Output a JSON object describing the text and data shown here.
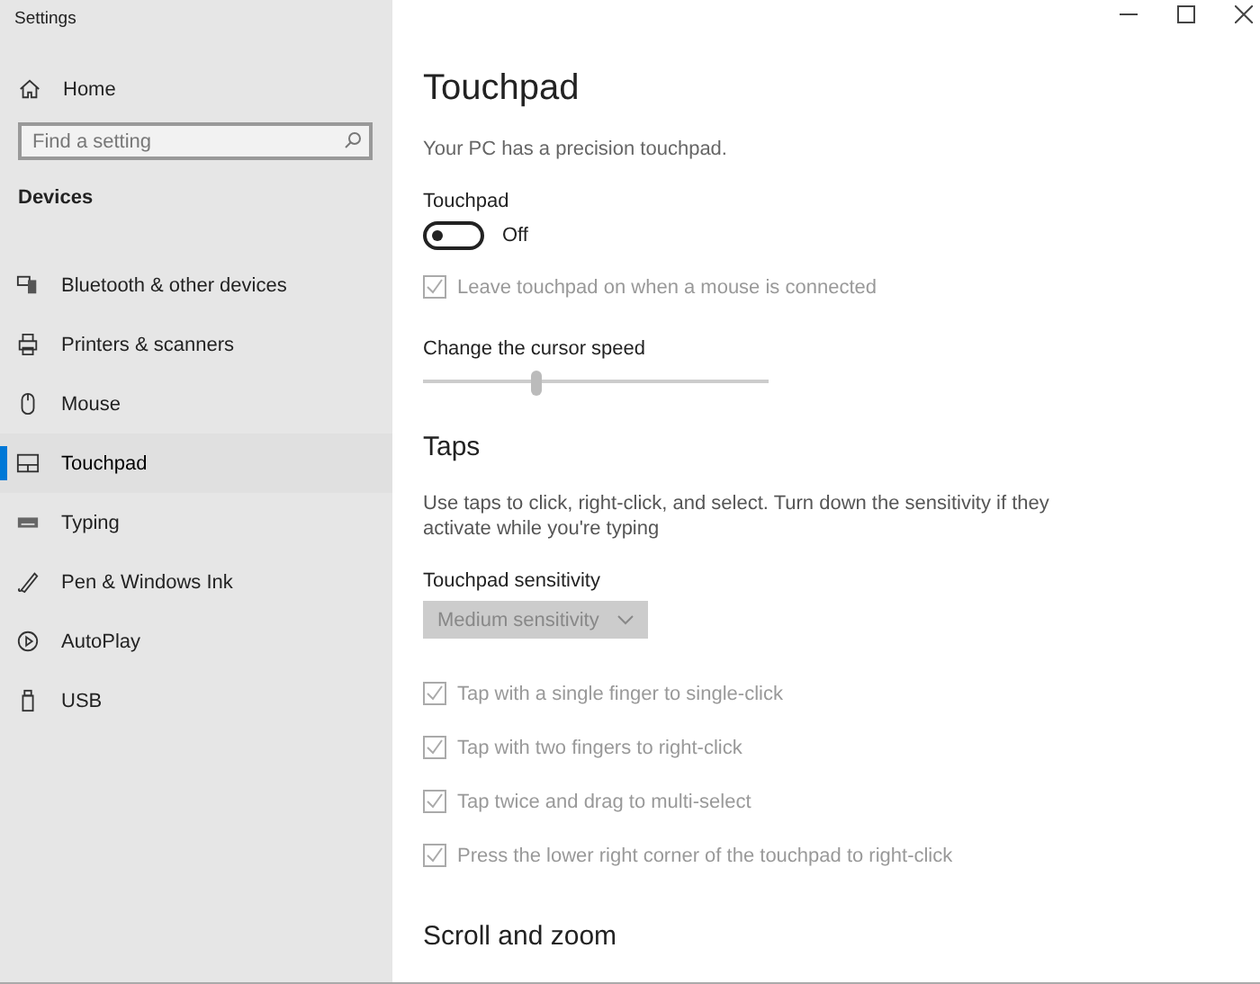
{
  "window": {
    "title": "Settings"
  },
  "sidebar": {
    "home": "Home",
    "search": {
      "placeholder": "Find a setting"
    },
    "section": "Devices",
    "items": [
      {
        "label": "Bluetooth & other devices",
        "selected": false
      },
      {
        "label": "Printers & scanners",
        "selected": false
      },
      {
        "label": "Mouse",
        "selected": false
      },
      {
        "label": "Touchpad",
        "selected": true
      },
      {
        "label": "Typing",
        "selected": false
      },
      {
        "label": "Pen & Windows Ink",
        "selected": false
      },
      {
        "label": "AutoPlay",
        "selected": false
      },
      {
        "label": "USB",
        "selected": false
      }
    ]
  },
  "page": {
    "title": "Touchpad",
    "subtitle": "Your PC has a precision touchpad.",
    "toggle": {
      "label": "Touchpad",
      "on": false,
      "state_text": "Off"
    },
    "leave_on": {
      "label": "Leave touchpad on when a mouse is connected",
      "checked": true,
      "disabled": true
    },
    "speed": {
      "label": "Change the cursor speed",
      "level": 0.33
    },
    "taps": {
      "heading": "Taps",
      "description": "Use taps to click, right-click, and select. Turn down the sensitivity if they activate while you're typing",
      "sensitivity_label": "Touchpad sensitivity",
      "sensitivity": {
        "value": "Medium sensitivity",
        "disabled": true
      },
      "options": [
        {
          "label": "Tap with a single finger to single-click",
          "checked": true,
          "disabled": true
        },
        {
          "label": "Tap with two fingers to right-click",
          "checked": true,
          "disabled": true
        },
        {
          "label": "Tap twice and drag to multi-select",
          "checked": true,
          "disabled": true
        },
        {
          "label": "Press the lower right corner of the touchpad to right-click",
          "checked": true,
          "disabled": true
        }
      ]
    },
    "scroll_heading": "Scroll and zoom"
  }
}
